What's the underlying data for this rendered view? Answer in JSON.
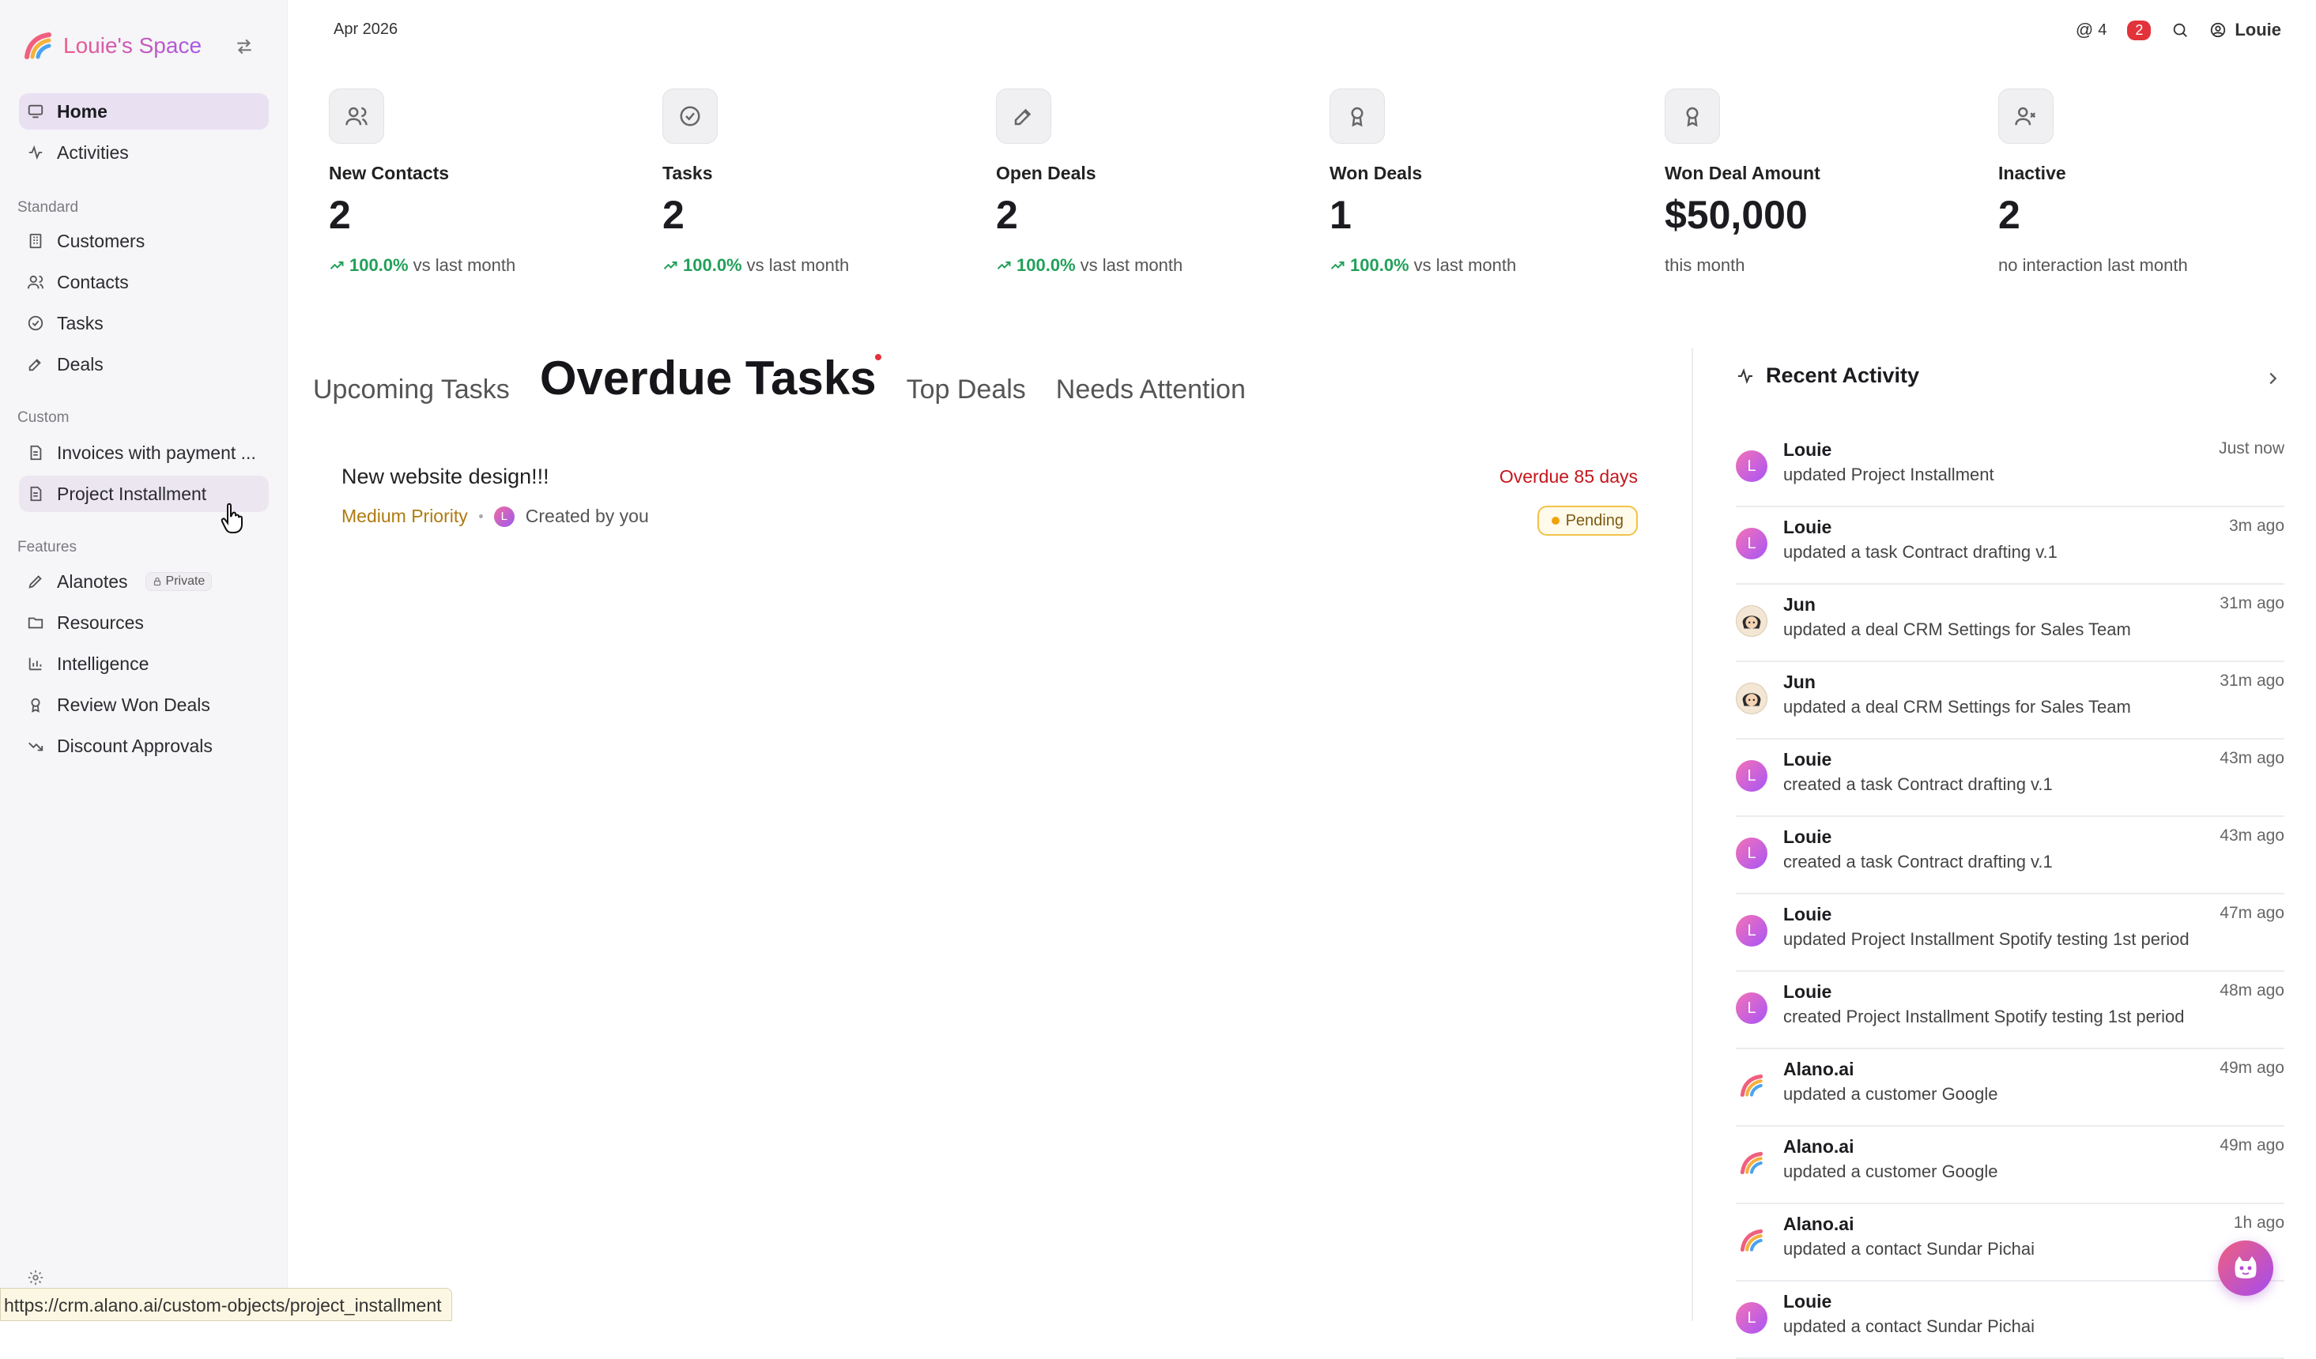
{
  "sidebar": {
    "brand": "Louie's Space",
    "nav_main": [
      {
        "label": "Home",
        "icon": "monitor-icon"
      },
      {
        "label": "Activities",
        "icon": "activity-icon"
      }
    ],
    "section_standard": "Standard",
    "nav_standard": [
      {
        "label": "Customers",
        "icon": "building-icon"
      },
      {
        "label": "Contacts",
        "icon": "users-icon"
      },
      {
        "label": "Tasks",
        "icon": "check-circle-icon"
      },
      {
        "label": "Deals",
        "icon": "edit-icon"
      }
    ],
    "section_custom": "Custom",
    "nav_custom": [
      {
        "label": "Invoices with payment ...",
        "icon": "file-icon"
      },
      {
        "label": "Project Installment",
        "icon": "file-icon"
      }
    ],
    "section_features": "Features",
    "nav_features": [
      {
        "label": "Alanotes",
        "icon": "pen-icon",
        "badge": "Private"
      },
      {
        "label": "Resources",
        "icon": "folder-icon"
      },
      {
        "label": "Intelligence",
        "icon": "bar-chart-icon"
      },
      {
        "label": "Review Won Deals",
        "icon": "award-icon"
      },
      {
        "label": "Discount Approvals",
        "icon": "trending-down-icon"
      }
    ],
    "status_url": "https://crm.alano.ai/custom-objects/project_installment"
  },
  "topbar": {
    "date": "Apr 2026",
    "mentions": "4",
    "notifications": "2",
    "user": "Louie"
  },
  "stats": [
    {
      "label": "New Contacts",
      "value": "2",
      "pct": "100.0%",
      "suffix": "vs last month",
      "icon": "users-icon"
    },
    {
      "label": "Tasks",
      "value": "2",
      "pct": "100.0%",
      "suffix": "vs last month",
      "icon": "check-circle-icon"
    },
    {
      "label": "Open Deals",
      "value": "2",
      "pct": "100.0%",
      "suffix": "vs last month",
      "icon": "edit-icon"
    },
    {
      "label": "Won Deals",
      "value": "1",
      "pct": "100.0%",
      "suffix": "vs last month",
      "icon": "award-icon"
    },
    {
      "label": "Won Deal Amount",
      "value": "$50,000",
      "pct": "",
      "suffix": "this month",
      "icon": "award-icon"
    },
    {
      "label": "Inactive",
      "value": "2",
      "pct": "",
      "suffix": "no interaction last month",
      "icon": "user-x-icon"
    }
  ],
  "tabs": [
    "Upcoming Tasks",
    "Overdue Tasks",
    "Top Deals",
    "Needs Attention"
  ],
  "task": {
    "title": "New website design!!!",
    "overdue": "Overdue 85 days",
    "priority": "Medium Priority",
    "avatar_letter": "L",
    "created_by": "Created by you",
    "status": "Pending"
  },
  "activity": {
    "title": "Recent Activity",
    "items": [
      {
        "name": "Louie",
        "desc": "updated Project Installment",
        "time": "Just now",
        "avatar": "louie",
        "letter": "L"
      },
      {
        "name": "Louie",
        "desc": "updated a task Contract drafting v.1",
        "time": "3m ago",
        "avatar": "louie",
        "letter": "L"
      },
      {
        "name": "Jun",
        "desc": "updated a deal CRM Settings for Sales Team",
        "time": "31m ago",
        "avatar": "jun",
        "letter": ""
      },
      {
        "name": "Jun",
        "desc": "updated a deal CRM Settings for Sales Team",
        "time": "31m ago",
        "avatar": "jun",
        "letter": ""
      },
      {
        "name": "Louie",
        "desc": "created a task Contract drafting v.1",
        "time": "43m ago",
        "avatar": "louie",
        "letter": "L"
      },
      {
        "name": "Louie",
        "desc": "created a task Contract drafting v.1",
        "time": "43m ago",
        "avatar": "louie",
        "letter": "L"
      },
      {
        "name": "Louie",
        "desc": "updated Project Installment Spotify testing 1st period",
        "time": "47m ago",
        "avatar": "louie",
        "letter": "L"
      },
      {
        "name": "Louie",
        "desc": "created Project Installment Spotify testing 1st period",
        "time": "48m ago",
        "avatar": "louie",
        "letter": "L"
      },
      {
        "name": "Alano.ai",
        "desc": "updated a customer Google",
        "time": "49m ago",
        "avatar": "alano",
        "letter": ""
      },
      {
        "name": "Alano.ai",
        "desc": "updated a customer Google",
        "time": "49m ago",
        "avatar": "alano",
        "letter": ""
      },
      {
        "name": "Alano.ai",
        "desc": "updated a contact Sundar Pichai",
        "time": "1h ago",
        "avatar": "alano",
        "letter": ""
      },
      {
        "name": "Louie",
        "desc": "updated a contact Sundar Pichai",
        "time": "",
        "avatar": "louie",
        "letter": "L"
      }
    ]
  },
  "colors": {
    "accent": "#a855f7",
    "active_nav_bg": "#e9e0f2",
    "positive": "#22a05a",
    "overdue": "#c4161c",
    "priority": "#b07a10",
    "notification": "#e2323a"
  }
}
